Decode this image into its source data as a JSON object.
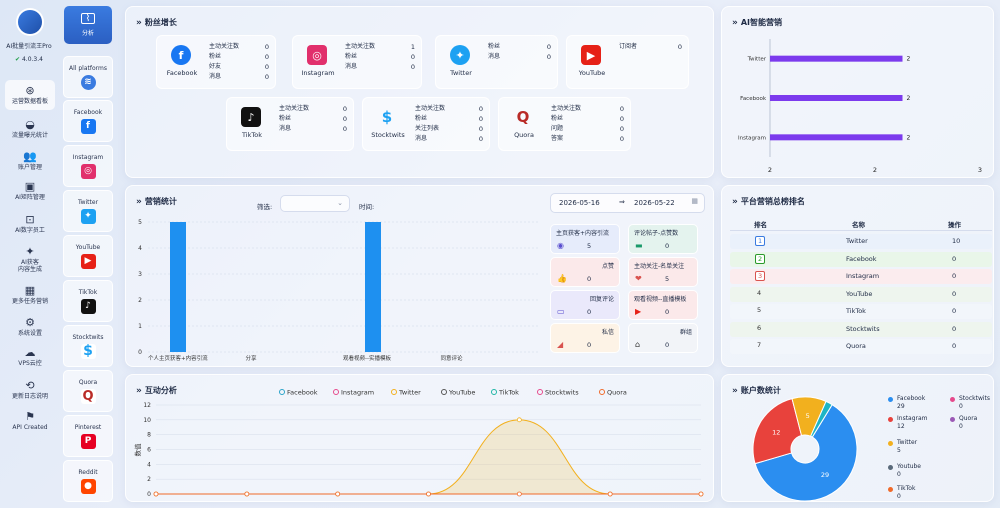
{
  "app": {
    "name": "AI批量引流王Pro",
    "version": "4.0.3.4"
  },
  "nav": [
    {
      "label": "运营数据看板",
      "icon": "dashboard-icon",
      "glyph": "⊛"
    },
    {
      "label": "流量曝光统计",
      "icon": "gauge-icon",
      "glyph": "◒"
    },
    {
      "label": "账户管理",
      "icon": "users-icon",
      "glyph": "👥"
    },
    {
      "label": "AI矩阵管理",
      "icon": "clipboard-icon",
      "glyph": "▣"
    },
    {
      "label": "AI数字员工",
      "icon": "robot-icon",
      "glyph": "⊡"
    },
    {
      "label": "AI获客\n内容生成",
      "icon": "sparkle-icon",
      "glyph": "✦"
    },
    {
      "label": "更多任务营销",
      "icon": "grid-icon",
      "glyph": "▦"
    },
    {
      "label": "系统设置",
      "icon": "gear-icon",
      "glyph": "⚙"
    },
    {
      "label": "VPS云控",
      "icon": "cloud-icon",
      "glyph": "☁"
    },
    {
      "label": "更新日志说明",
      "icon": "history-icon",
      "glyph": "⟲"
    },
    {
      "label": "API Created",
      "icon": "flag-icon",
      "glyph": "⚑"
    }
  ],
  "top_tab": {
    "label": "分析"
  },
  "platforms": [
    {
      "label": "All platforms",
      "color": "#3a7be0",
      "glyph": "≋"
    },
    {
      "label": "Facebook",
      "color": "#1877f2",
      "glyph": "f"
    },
    {
      "label": "Instagram",
      "color": "#e1306c",
      "glyph": "◎"
    },
    {
      "label": "Twitter",
      "color": "#1da1f2",
      "glyph": "✦"
    },
    {
      "label": "YouTube",
      "color": "#e62117",
      "glyph": "▶"
    },
    {
      "label": "TikTok",
      "color": "#111111",
      "glyph": "♪"
    },
    {
      "label": "Stocktwits",
      "color": "#ffffff",
      "glyph": "$"
    },
    {
      "label": "Quora",
      "color": "#ffffff",
      "glyph": "Q"
    },
    {
      "label": "Pinterest",
      "color": "#e60023",
      "glyph": "P"
    },
    {
      "label": "Reddit",
      "color": "#ff4500",
      "glyph": "●"
    }
  ],
  "fans": {
    "title": "粉丝增长",
    "cards": [
      {
        "name": "Facebook",
        "glyph": "f",
        "color": "#1877f2",
        "rows": [
          {
            "k": "主动关注数",
            "v": "0"
          },
          {
            "k": "粉丝",
            "v": "0"
          },
          {
            "k": "好友",
            "v": "0"
          },
          {
            "k": "消息",
            "v": "0"
          }
        ]
      },
      {
        "name": "Instagram",
        "glyph": "◎",
        "color": "#e1306c",
        "rows": [
          {
            "k": "主动关注数",
            "v": "1"
          },
          {
            "k": "粉丝",
            "v": "0"
          },
          {
            "k": "消息",
            "v": "0"
          }
        ]
      },
      {
        "name": "Twitter",
        "glyph": "✦",
        "color": "#1da1f2",
        "rows": [
          {
            "k": "粉丝",
            "v": "0"
          },
          {
            "k": "消息",
            "v": "0"
          }
        ]
      },
      {
        "name": "YouTube",
        "glyph": "▶",
        "color": "#e62117",
        "rows": [
          {
            "k": "订阅者",
            "v": "0"
          }
        ]
      },
      {
        "name": "TikTok",
        "glyph": "♪",
        "color": "#111111",
        "rows": [
          {
            "k": "主动关注数",
            "v": "0"
          },
          {
            "k": "粉丝",
            "v": "0"
          },
          {
            "k": "消息",
            "v": "0"
          }
        ]
      },
      {
        "name": "Stocktwits",
        "glyph": "$",
        "color": "#1da1f2",
        "rows": [
          {
            "k": "主动关注数",
            "v": "0"
          },
          {
            "k": "粉丝",
            "v": "0"
          },
          {
            "k": "关注列表",
            "v": "0"
          },
          {
            "k": "消息",
            "v": "0"
          }
        ]
      },
      {
        "name": "Quora",
        "glyph": "Q",
        "color": "#b92b27",
        "rows": [
          {
            "k": "主动关注数",
            "v": "0"
          },
          {
            "k": "粉丝",
            "v": "0"
          },
          {
            "k": "问题",
            "v": "0"
          },
          {
            "k": "答案",
            "v": "0"
          }
        ]
      }
    ]
  },
  "ai_marketing": {
    "title": "AI智能营销"
  },
  "marketing": {
    "title": "营销统计",
    "filter_label": "筛选:",
    "time_label": "时间:",
    "date_from": "2026-05-16",
    "date_to": "2026-05-22",
    "cards": [
      {
        "label": "主页获客+内容引流",
        "right": "",
        "value": "5",
        "glyph": "◉",
        "bg": "#e6ecfb",
        "gc": "#5a4fcf"
      },
      {
        "label": "评论帖子-点赞数",
        "right": "",
        "value": "0",
        "glyph": "▬",
        "bg": "#e4f3ee",
        "gc": "#1a9a6a"
      },
      {
        "label": "",
        "right": "点赞",
        "value": "0",
        "glyph": "👍",
        "bg": "#fbe9ea",
        "gc": "#d9534f"
      },
      {
        "label": "主动关注-名单关注",
        "right": "",
        "value": "5",
        "glyph": "❤",
        "bg": "#fbe9ea",
        "gc": "#d9534f"
      },
      {
        "label": "",
        "right": "回复评论",
        "value": "0",
        "glyph": "▭",
        "bg": "#eae9fb",
        "gc": "#5a4fcf"
      },
      {
        "label": "观看视频--直播模板",
        "right": "",
        "value": "0",
        "glyph": "▶",
        "bg": "#fbe9ea",
        "gc": "#e62117"
      },
      {
        "label": "",
        "right": "私信",
        "value": "0",
        "glyph": "◢",
        "bg": "#fdf3e6",
        "gc": "#d9534f"
      },
      {
        "label": "",
        "right": "群组",
        "value": "0",
        "glyph": "⌂",
        "bg": "#f2f4f8",
        "gc": "#333"
      }
    ]
  },
  "interaction": {
    "title": "互动分析"
  },
  "rank": {
    "title": "平台营销总榜排名",
    "headers": [
      "排名",
      "名称",
      "操作"
    ],
    "rows": [
      {
        "rank": "1",
        "name": "Twitter",
        "value": "10",
        "bg": "#eaf1fb",
        "rc": "#3a7be0"
      },
      {
        "rank": "2",
        "name": "Facebook",
        "value": "0",
        "bg": "#e9f6e9",
        "rc": "#2a9a2a"
      },
      {
        "rank": "3",
        "name": "Instagram",
        "value": "0",
        "bg": "#fbecee",
        "rc": "#d9534f"
      },
      {
        "rank": "4",
        "name": "YouTube",
        "value": "0",
        "bg": "#eef5ee",
        "rc": "#333"
      },
      {
        "rank": "5",
        "name": "TikTok",
        "value": "0",
        "bg": "#f2f6fb",
        "rc": "#333"
      },
      {
        "rank": "6",
        "name": "Stocktwits",
        "value": "0",
        "bg": "#eef5ee",
        "rc": "#333"
      },
      {
        "rank": "7",
        "name": "Quora",
        "value": "0",
        "bg": "#f2f6fb",
        "rc": "#333"
      }
    ]
  },
  "accounts": {
    "title": "账户数统计"
  },
  "chart_data": [
    {
      "type": "bar",
      "orientation": "horizontal",
      "categories": [
        "Twitter",
        "Facebook",
        "Instagram"
      ],
      "values": [
        2,
        2,
        2
      ],
      "x_ticks": [
        "2",
        "2",
        "3"
      ],
      "color": "#7c3aed"
    },
    {
      "type": "bar",
      "categories": [
        "个人主页获客+内容引流",
        "分享",
        "观看视频--实播模板",
        "同意评论"
      ],
      "values": [
        5,
        0,
        5,
        0
      ],
      "ylim": [
        0,
        5
      ],
      "yticks": [
        0,
        1,
        2,
        3,
        4,
        5
      ],
      "color": "#1e90f0"
    },
    {
      "type": "line",
      "legend": [
        "Facebook",
        "Instagram",
        "Twitter",
        "YouTube",
        "TikTok",
        "Stocktwits",
        "Quora"
      ],
      "legend_colors": [
        "#2aa3c9",
        "#e64a8c",
        "#f2b01e",
        "#555555",
        "#1fb5a5",
        "#e64a8c",
        "#f06a2a"
      ],
      "ylabel": "数值",
      "ylim": [
        0,
        12
      ],
      "yticks": [
        0,
        2,
        4,
        6,
        8,
        10,
        12
      ],
      "points": 7,
      "series": [
        {
          "name": "Twitter",
          "values": [
            0,
            0,
            0,
            0,
            10,
            0,
            0
          ],
          "color": "#f2b01e"
        },
        {
          "name": "Quora",
          "values": [
            0,
            0,
            0,
            0,
            0,
            0,
            0
          ],
          "color": "#f06a2a"
        }
      ]
    },
    {
      "type": "pie",
      "style": "donut",
      "slices": [
        {
          "label": "Facebook",
          "value": 29,
          "color": "#2b8ef0"
        },
        {
          "label": "Stocktwits",
          "value": 0,
          "color": "#e64a8c"
        },
        {
          "label": "Instagram",
          "value": 12,
          "color": "#e8423c"
        },
        {
          "label": "Quora",
          "value": 0,
          "color": "#9b59b6"
        },
        {
          "label": "Twitter",
          "value": 5,
          "color": "#f2b01e"
        },
        {
          "label": "Youtube",
          "value": 0,
          "color": "#5a6a7a"
        },
        {
          "label": "TikTok",
          "value": 0,
          "color": "#f06a2a"
        }
      ],
      "teal_slice": {
        "value": 1,
        "color": "#1fb5c5"
      }
    }
  ]
}
